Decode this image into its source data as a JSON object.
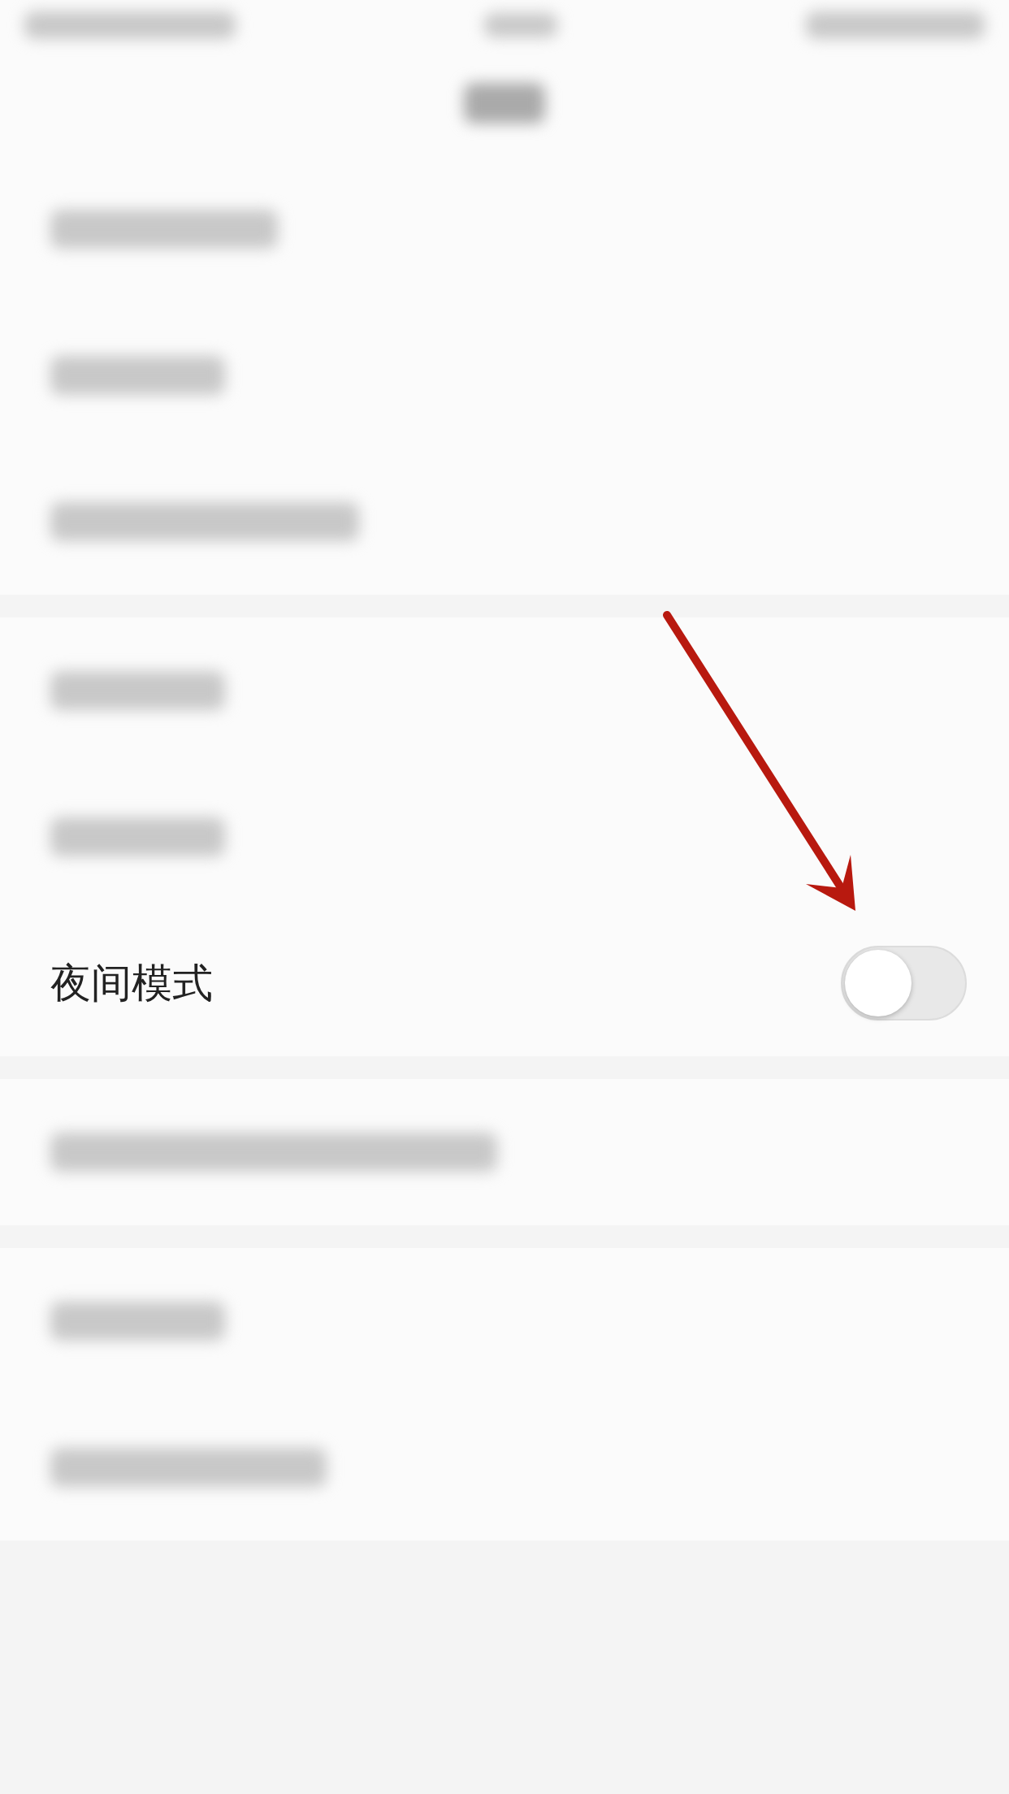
{
  "status_bar": {
    "kind": "blurred"
  },
  "nav_bar": {
    "kind": "blurred"
  },
  "groups": [
    {
      "rows": [
        {
          "kind": "blurred"
        },
        {
          "kind": "blurred"
        },
        {
          "kind": "blurred"
        }
      ]
    },
    {
      "rows": [
        {
          "kind": "blurred"
        },
        {
          "kind": "blurred"
        },
        {
          "kind": "toggle",
          "label": "夜间模式",
          "on": false
        }
      ]
    },
    {
      "rows": [
        {
          "kind": "blurred"
        }
      ]
    },
    {
      "rows": [
        {
          "kind": "blurred"
        },
        {
          "kind": "blurred"
        }
      ]
    }
  ],
  "annotation": {
    "kind": "arrow"
  }
}
